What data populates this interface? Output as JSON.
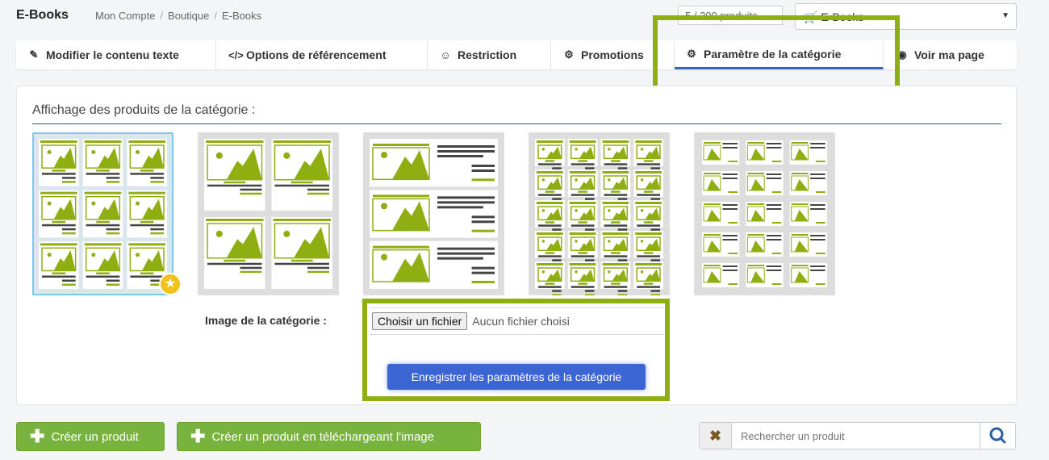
{
  "header": {
    "title": "E-Books",
    "breadcrumb": [
      "Mon Compte",
      "Boutique",
      "E-Books"
    ],
    "product_counter": "5 / 200 produits",
    "category_select": "E-Books"
  },
  "tabs": [
    {
      "label": "Modifier le contenu texte",
      "icon": "pencil-icon"
    },
    {
      "label": "Options de référencement",
      "icon": "code-icon"
    },
    {
      "label": "Restriction",
      "icon": "user-circle-icon"
    },
    {
      "label": "Promotions",
      "icon": "gear-icon"
    },
    {
      "label": "Paramètre de la catégorie",
      "icon": "gears-icon",
      "active": true
    },
    {
      "label": "Voir ma page",
      "icon": "globe-icon"
    }
  ],
  "panel": {
    "title": "Affichage des produits de la catégorie :",
    "layouts": [
      {
        "name": "grid-3-columns",
        "selected": true
      },
      {
        "name": "grid-2-columns",
        "selected": false
      },
      {
        "name": "list-rows",
        "selected": false
      },
      {
        "name": "grid-4-columns",
        "selected": false
      },
      {
        "name": "grid-compact",
        "selected": false
      }
    ],
    "image_label": "Image de la catégorie :",
    "file_button": "Choisir un fichier",
    "file_status": "Aucun fichier choisi",
    "save_button": "Enregistrer les paramètres de la catégorie"
  },
  "actions": {
    "create_product": "Créer un produit",
    "create_product_image": "Créer un produit en téléchargeant l'image"
  },
  "search": {
    "placeholder": "Rechercher un produit"
  },
  "colors": {
    "accent_green": "#8fae11",
    "primary_blue": "#3b65d3",
    "button_green": "#79b33f"
  }
}
